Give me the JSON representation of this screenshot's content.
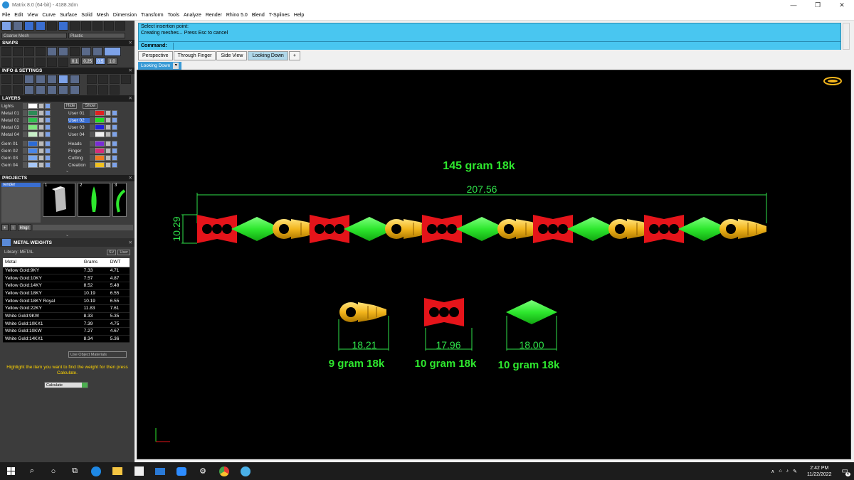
{
  "window": {
    "title": "Matrix 8.0 (64-bit) - 4188.3dm",
    "controls": [
      "—",
      "❐",
      "✕"
    ]
  },
  "menu": [
    "File",
    "Edit",
    "View",
    "Curve",
    "Surface",
    "Solid",
    "Mesh",
    "Dimension",
    "Transform",
    "Tools",
    "Analyze",
    "Render",
    "Rhino 5.0",
    "Blend",
    "T-Splines",
    "Help"
  ],
  "toolbar": {
    "mesh_select": "Coarse Mesh",
    "material_select": "Plastic"
  },
  "panels": {
    "snaps": "SNAPS",
    "snap_values": [
      "0.1",
      "0.25",
      "0.5",
      "1.0"
    ],
    "info": "INFO & SETTINGS",
    "layers": "LAYERS",
    "projects": "PROJECTS",
    "metal_weights": "METAL WEIGHTS"
  },
  "layers": {
    "lights": "Lights",
    "hide": "Hide",
    "show": "Show",
    "left": [
      {
        "name": "Metal 01",
        "color": "#2e8b57"
      },
      {
        "name": "Metal 02",
        "color": "#2fbf4f"
      },
      {
        "name": "Metal 03",
        "color": "#7ee87e"
      },
      {
        "name": "Metal 04",
        "color": "#c8f0c8"
      },
      {
        "name": "Gem 01",
        "color": "#2b6bd6"
      },
      {
        "name": "Gem 02",
        "color": "#4a86e8"
      },
      {
        "name": "Gem 03",
        "color": "#7aa8f0"
      },
      {
        "name": "Gem 04",
        "color": "#a8c8f8"
      }
    ],
    "right": [
      {
        "name": "User 01",
        "color": "#e02020"
      },
      {
        "name": "User 02",
        "color": "#20e020"
      },
      {
        "name": "User 03",
        "color": "#2020e0"
      },
      {
        "name": "User 04",
        "color": "#f0f0f0"
      },
      {
        "name": "Heads",
        "color": "#7a2bd6"
      },
      {
        "name": "Finger",
        "color": "#d62b7a"
      },
      {
        "name": "Cutting",
        "color": "#f07a20"
      },
      {
        "name": "Creation",
        "color": "#f0c020"
      }
    ]
  },
  "projects": {
    "list_item": "render",
    "thumbs": [
      "1",
      "2",
      "3"
    ],
    "hinge_btn": "Hngr"
  },
  "metal_weights": {
    "library_label": "Library: METAL",
    "btn_sv": "SV",
    "btn_user": "User",
    "columns": [
      "Metal",
      "Grams",
      "DWT"
    ],
    "rows": [
      [
        "Yellow Gold:9KY",
        "7.33",
        "4.71"
      ],
      [
        "Yellow Gold:10KY",
        "7.57",
        "4.87"
      ],
      [
        "Yellow Gold:14KY",
        "8.52",
        "5.48"
      ],
      [
        "Yellow Gold:18KY",
        "10.19",
        "6.55"
      ],
      [
        "Yellow Gold:18KY Royal",
        "10.19",
        "6.55"
      ],
      [
        "Yellow Gold:22KY",
        "11.83",
        "7.61"
      ],
      [
        "White Gold:9KW",
        "8.33",
        "5.35"
      ],
      [
        "White Gold:10KX1",
        "7.39",
        "4.75"
      ],
      [
        "White Gold:10KW",
        "7.27",
        "4.67"
      ],
      [
        "White Gold:14KX1",
        "8.34",
        "5.36"
      ]
    ],
    "use_object_materials": "Use Object Materials",
    "hint": "Highlight the item you want to find the weight for then press Calculate.",
    "calculate": "Calculate"
  },
  "command": {
    "line1": "Select insertion point:",
    "line2": "Creating meshes... Press Esc to cancel",
    "label": "Command:"
  },
  "tabs": [
    "Perspective",
    "Through Finger",
    "Side View",
    "Looking Down"
  ],
  "active_tab": "Looking Down",
  "view_label": "Looking Down",
  "viewport": {
    "total_weight": "145 gram 18k",
    "width_dim": "207.56",
    "height_dim": "10.29",
    "parts": [
      {
        "dim": "18.21",
        "weight": "9 gram 18k"
      },
      {
        "dim": "17.96",
        "weight": "10 gram 18k"
      },
      {
        "dim": "18.00",
        "weight": "10 gram 18k"
      }
    ],
    "colors": {
      "gold": "#f2b51c",
      "red": "#e5141a",
      "green": "#2ee82e",
      "dim": "#2fe24a"
    }
  },
  "taskbar": {
    "time": "2:42 PM",
    "date": "11/22/2022",
    "notifications": "4"
  }
}
